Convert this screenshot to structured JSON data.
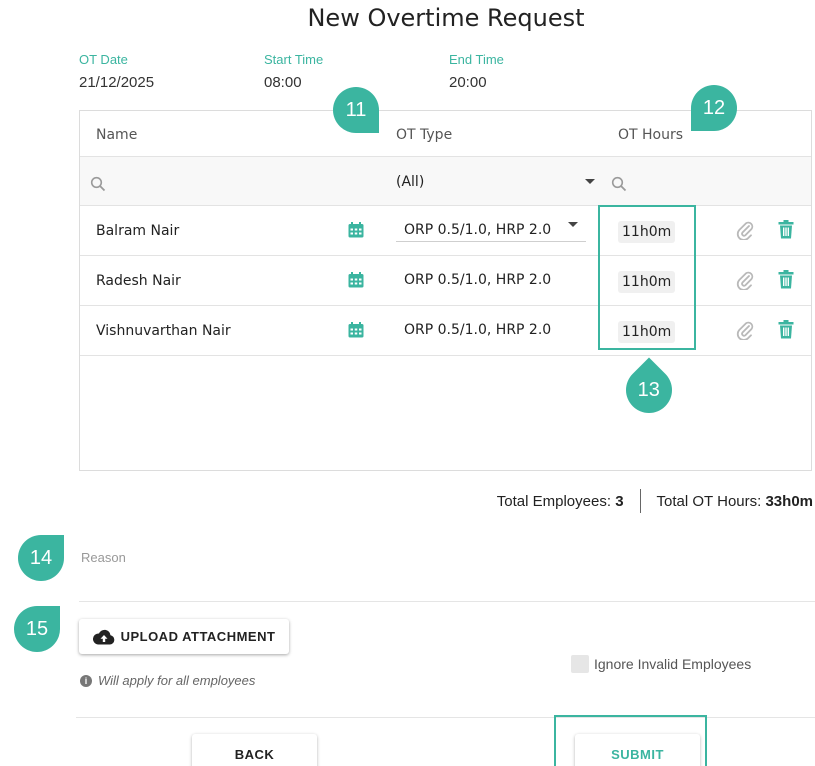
{
  "page": {
    "title": "New Overtime Request"
  },
  "meta": {
    "ot_date": {
      "label": "OT Date",
      "value": "21/12/2025"
    },
    "start_time": {
      "label": "Start Time",
      "value": "08:00"
    },
    "end_time": {
      "label": "End Time",
      "value": "20:00"
    }
  },
  "grid": {
    "columns": {
      "name": "Name",
      "ot_type": "OT Type",
      "ot_hours": "OT Hours"
    },
    "filter": {
      "ot_type_value": "(All)"
    },
    "rows": [
      {
        "name": "Balram Nair",
        "ot_type": "ORP 0.5/1.0, HRP 2.0",
        "ot_hours": "11h0m"
      },
      {
        "name": "Radesh Nair",
        "ot_type": "ORP 0.5/1.0, HRP 2.0",
        "ot_hours": "11h0m"
      },
      {
        "name": "Vishnuvarthan Nair",
        "ot_type": "ORP 0.5/1.0, HRP 2.0",
        "ot_hours": "11h0m"
      }
    ]
  },
  "totals": {
    "employees_label": "Total Employees:",
    "employees_value": "3",
    "hours_label": "Total OT Hours:",
    "hours_value": "33h0m"
  },
  "reason": {
    "label": "Reason"
  },
  "upload": {
    "label": "UPLOAD ATTACHMENT",
    "hint": "Will apply for all employees"
  },
  "ignore_invalid": {
    "label": "Ignore Invalid Employees"
  },
  "actions": {
    "back": "BACK",
    "submit": "SUBMIT"
  },
  "markers": [
    "11",
    "12",
    "13",
    "14",
    "15"
  ],
  "colors": {
    "accent": "#3bb5a0",
    "marker": "#3bb5a0"
  },
  "icons": [
    "search-icon",
    "chevron-down-icon",
    "calendar-icon",
    "paperclip-icon",
    "trash-icon",
    "cloud-upload-icon",
    "info-icon"
  ]
}
